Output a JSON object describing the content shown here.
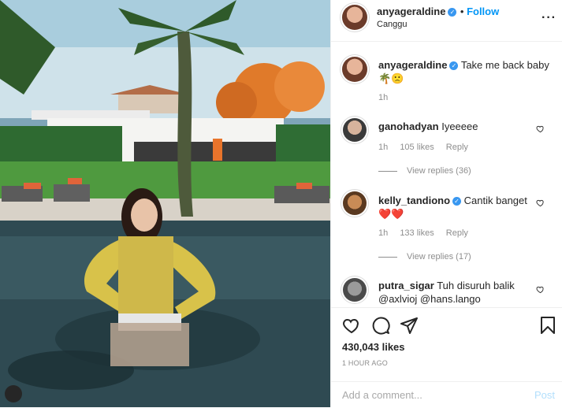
{
  "post": {
    "username": "anyageraldine",
    "location": "Canggu",
    "follow_label": "Follow",
    "more_icon": "more-dots-icon"
  },
  "caption": {
    "username": "anyageraldine",
    "text": "Take me back baby 🌴🙁",
    "time": "1h"
  },
  "comments": [
    {
      "username": "ganohadyan",
      "text": "Iyeeeee",
      "time": "1h",
      "likes": "105 likes",
      "reply": "Reply",
      "view_replies": "View replies (36)"
    },
    {
      "username": "kelly_tandiono",
      "text": "Cantik banget ❤️❤️",
      "time": "1h",
      "likes": "133 likes",
      "reply": "Reply",
      "view_replies": "View replies (17)"
    },
    {
      "username": "putra_sigar",
      "text": "Tuh disuruh balik @axlvioj @hans.lango"
    }
  ],
  "actions": {
    "likes": "430,043 likes",
    "timestamp": "1 HOUR AGO"
  },
  "add_comment": {
    "placeholder": "Add a comment...",
    "post_label": "Post"
  }
}
